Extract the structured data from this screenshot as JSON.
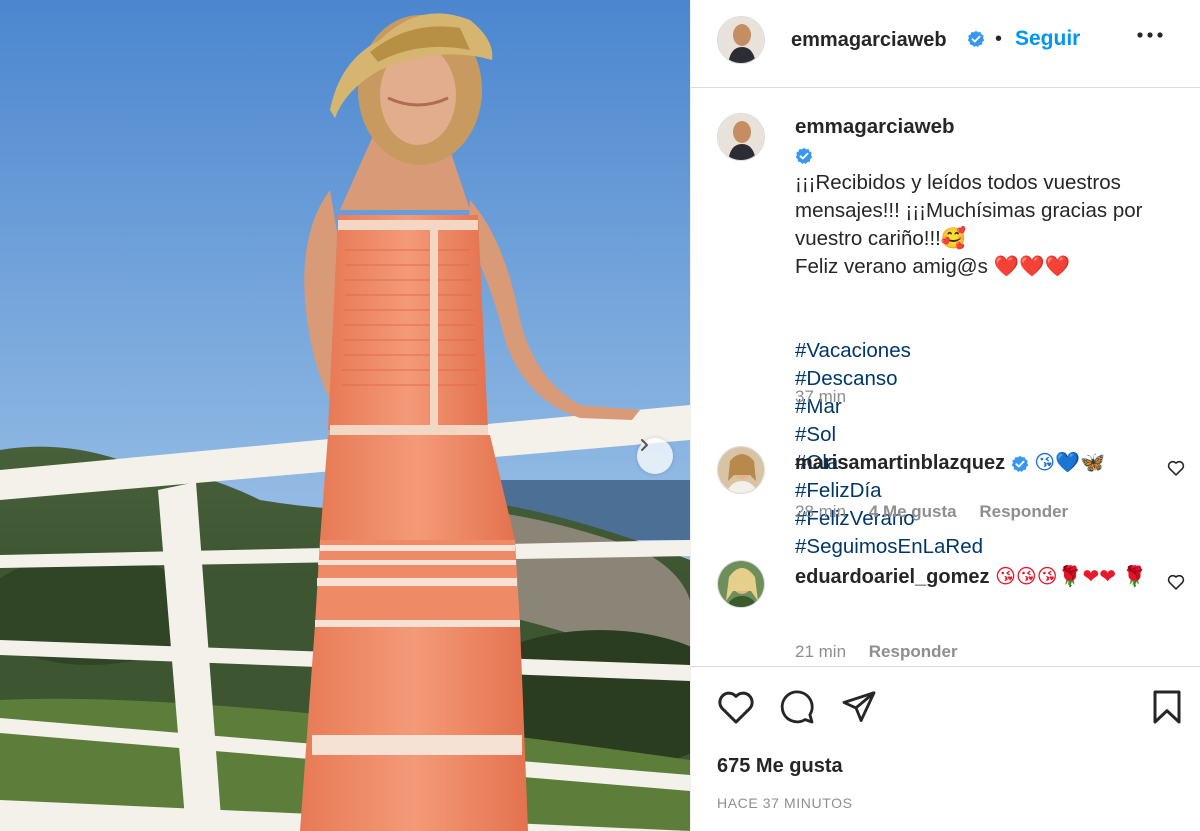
{
  "post": {
    "username": "emmagarciaweb",
    "separator": "•",
    "follow_label": "Seguir",
    "caption": {
      "text": "¡¡¡Recibidos y leídos todos vuestros mensajes!!! ¡¡¡Muchísimas gracias por vuestro cariño!!!🥰\nFeliz verano amig@s ❤️❤️❤️",
      "hashtags": [
        "#Vacaciones",
        "#Descanso",
        "#Mar",
        "#Sol",
        "#Olas",
        "#FelizDía",
        "#FelizVerano",
        "#SeguimosEnLaRed"
      ],
      "time": "37 min"
    },
    "likes": "675 Me gusta",
    "time_ago": "HACE 37 MINUTOS"
  },
  "comments": [
    {
      "username": "marisamartinblazquez",
      "verified": true,
      "text": "😘💙🦋",
      "time": "28 min",
      "likes": "4 Me gusta",
      "reply": "Responder"
    },
    {
      "username": "eduardoariel_gomez",
      "verified": false,
      "text": "😘😘😘🌹❤❤ 🌹",
      "time": "21 min",
      "reply": "Responder"
    }
  ],
  "icons": {
    "verified": "verified-badge-icon",
    "more": "more-options-icon",
    "like": "heart-icon",
    "comment": "comment-icon",
    "share": "share-icon",
    "save": "bookmark-icon",
    "next": "chevron-right-icon"
  },
  "colors": {
    "link_blue": "#0095f6",
    "hashtag": "#00376b",
    "muted": "#8e8e8e",
    "text": "#262626"
  }
}
